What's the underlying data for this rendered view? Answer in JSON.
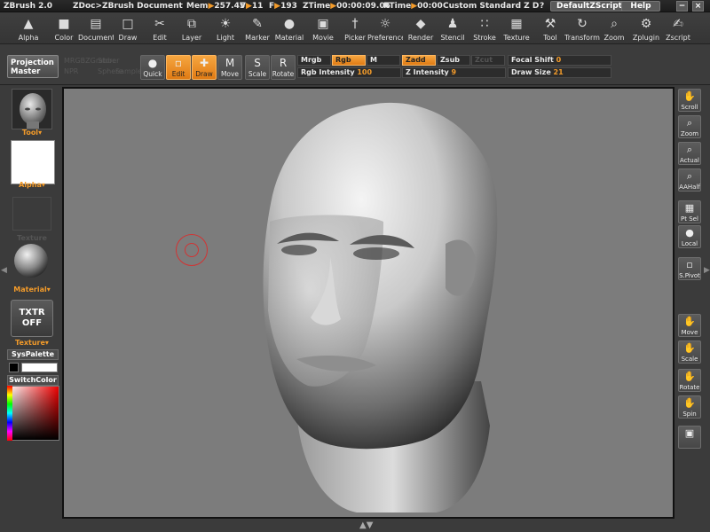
{
  "titlebar": {
    "app": "ZBrush 2.0",
    "document": "ZDoc>ZBrush Document",
    "mem_label": "Mem",
    "mem_value": "257.45",
    "v_label": "V",
    "v_value": "11",
    "f_label": "F",
    "f_value": "193",
    "ztime_label": "ZTime",
    "ztime_value": "00:00:09.06",
    "rtime_label": "RTime",
    "rtime_value": "00:00",
    "material_mode": "Custom Standard Z D",
    "question": "?",
    "default_script": "DefaultZScript",
    "help": "Help",
    "minimize": "−",
    "close": "×"
  },
  "menu": [
    {
      "label": "Alpha",
      "icon": "alpha-icon",
      "glyph": "▲"
    },
    {
      "label": "Color",
      "icon": "color-icon",
      "glyph": "■"
    },
    {
      "label": "Document",
      "icon": "document-icon",
      "glyph": "▤"
    },
    {
      "label": "Draw",
      "icon": "draw-icon",
      "glyph": "□"
    },
    {
      "label": "Edit",
      "icon": "edit-icon",
      "glyph": "✂"
    },
    {
      "label": "Layer",
      "icon": "layer-icon",
      "glyph": "⧉"
    },
    {
      "label": "Light",
      "icon": "light-icon",
      "glyph": "☀"
    },
    {
      "label": "Marker",
      "icon": "marker-icon",
      "glyph": "✎"
    },
    {
      "label": "Material",
      "icon": "material-icon",
      "glyph": "●"
    },
    {
      "label": "Movie",
      "icon": "movie-icon",
      "glyph": "▣"
    },
    {
      "label": "Picker",
      "icon": "picker-icon",
      "glyph": "†"
    },
    {
      "label": "Preferences",
      "icon": "preferences-icon",
      "glyph": "☼"
    },
    {
      "label": "Render",
      "icon": "render-icon",
      "glyph": "◆"
    },
    {
      "label": "Stencil",
      "icon": "stencil-icon",
      "glyph": "♟"
    },
    {
      "label": "Stroke",
      "icon": "stroke-icon",
      "glyph": "∷"
    },
    {
      "label": "Texture",
      "icon": "texture-icon",
      "glyph": "▦"
    },
    {
      "label": "Tool",
      "icon": "tool-icon",
      "glyph": "⚒"
    },
    {
      "label": "Transform",
      "icon": "transform-icon",
      "glyph": "↻"
    },
    {
      "label": "Zoom",
      "icon": "zoom-icon",
      "glyph": "⌕"
    },
    {
      "label": "Zplugin",
      "icon": "zplugin-icon",
      "glyph": "⚙"
    },
    {
      "label": "Zscript",
      "icon": "zscript-icon",
      "glyph": "✍"
    }
  ],
  "toolbar": {
    "projection_master": "Projection Master",
    "ghost": [
      "MRGBZGrabber",
      "NPR",
      "Store",
      "Sphere",
      "Sample"
    ],
    "buttons": [
      {
        "label": "Quick",
        "icon": "quick-icon",
        "glyph": "●",
        "active": false
      },
      {
        "label": "Edit",
        "icon": "edit-mode-icon",
        "glyph": "▫",
        "active": true
      },
      {
        "label": "Draw",
        "icon": "draw-mode-icon",
        "glyph": "✚",
        "active": true
      },
      {
        "label": "Move",
        "icon": "move-mode-icon",
        "glyph": "M",
        "active": false
      },
      {
        "label": "Scale",
        "icon": "scale-mode-icon",
        "glyph": "S",
        "active": false
      },
      {
        "label": "Rotate",
        "icon": "rotate-mode-icon",
        "glyph": "R",
        "active": false
      }
    ],
    "mrgb": "Mrgb",
    "rgb": "Rgb",
    "m": "M",
    "zadd": "Zadd",
    "zsub": "Zsub",
    "zcut": "Zcut",
    "rgb_intensity_label": "Rgb Intensity",
    "rgb_intensity_value": "100",
    "z_intensity_label": "Z Intensity",
    "z_intensity_value": "9",
    "focal_shift_label": "Focal Shift",
    "focal_shift_value": "0",
    "draw_size_label": "Draw Size",
    "draw_size_value": "21"
  },
  "left_panel": {
    "tool_label": "Tool",
    "alpha_label": "Alpha",
    "texture_ghost_label": "Texture",
    "material_label": "Material",
    "txtr_line1": "TXTR",
    "txtr_line2": "OFF",
    "texture_label": "Texture",
    "syspalette": "SysPalette",
    "switchcolor": "SwitchColor"
  },
  "right_shelf": [
    {
      "label": "Scroll",
      "icon": "scroll-icon",
      "glyph": "✋"
    },
    {
      "label": "Zoom",
      "icon": "zoom-view-icon",
      "glyph": "⌕"
    },
    {
      "label": "Actual",
      "icon": "actual-icon",
      "glyph": "⌕"
    },
    {
      "label": "AAHalf",
      "icon": "aahalf-icon",
      "glyph": "⌕"
    },
    {
      "label": "Pt Sel",
      "icon": "point-select-icon",
      "glyph": "▦"
    },
    {
      "label": "Local",
      "icon": "local-icon",
      "glyph": "●"
    },
    {
      "label": "S.Pivot",
      "icon": "pivot-icon",
      "glyph": "▫"
    },
    {
      "label": "Move",
      "icon": "move-view-icon",
      "glyph": "✋"
    },
    {
      "label": "Scale",
      "icon": "scale-view-icon",
      "glyph": "✋"
    },
    {
      "label": "Rotate",
      "icon": "rotate-view-icon",
      "glyph": "✋"
    },
    {
      "label": "Spin",
      "icon": "spin-icon",
      "glyph": "✋"
    },
    {
      "label": "",
      "icon": "camera-icon",
      "glyph": "▣"
    }
  ],
  "colors": {
    "accent": "#f39b2a",
    "canvas": "#7c7c7c",
    "brush_cursor": "#d23333",
    "panel": "#3b3b3b"
  }
}
